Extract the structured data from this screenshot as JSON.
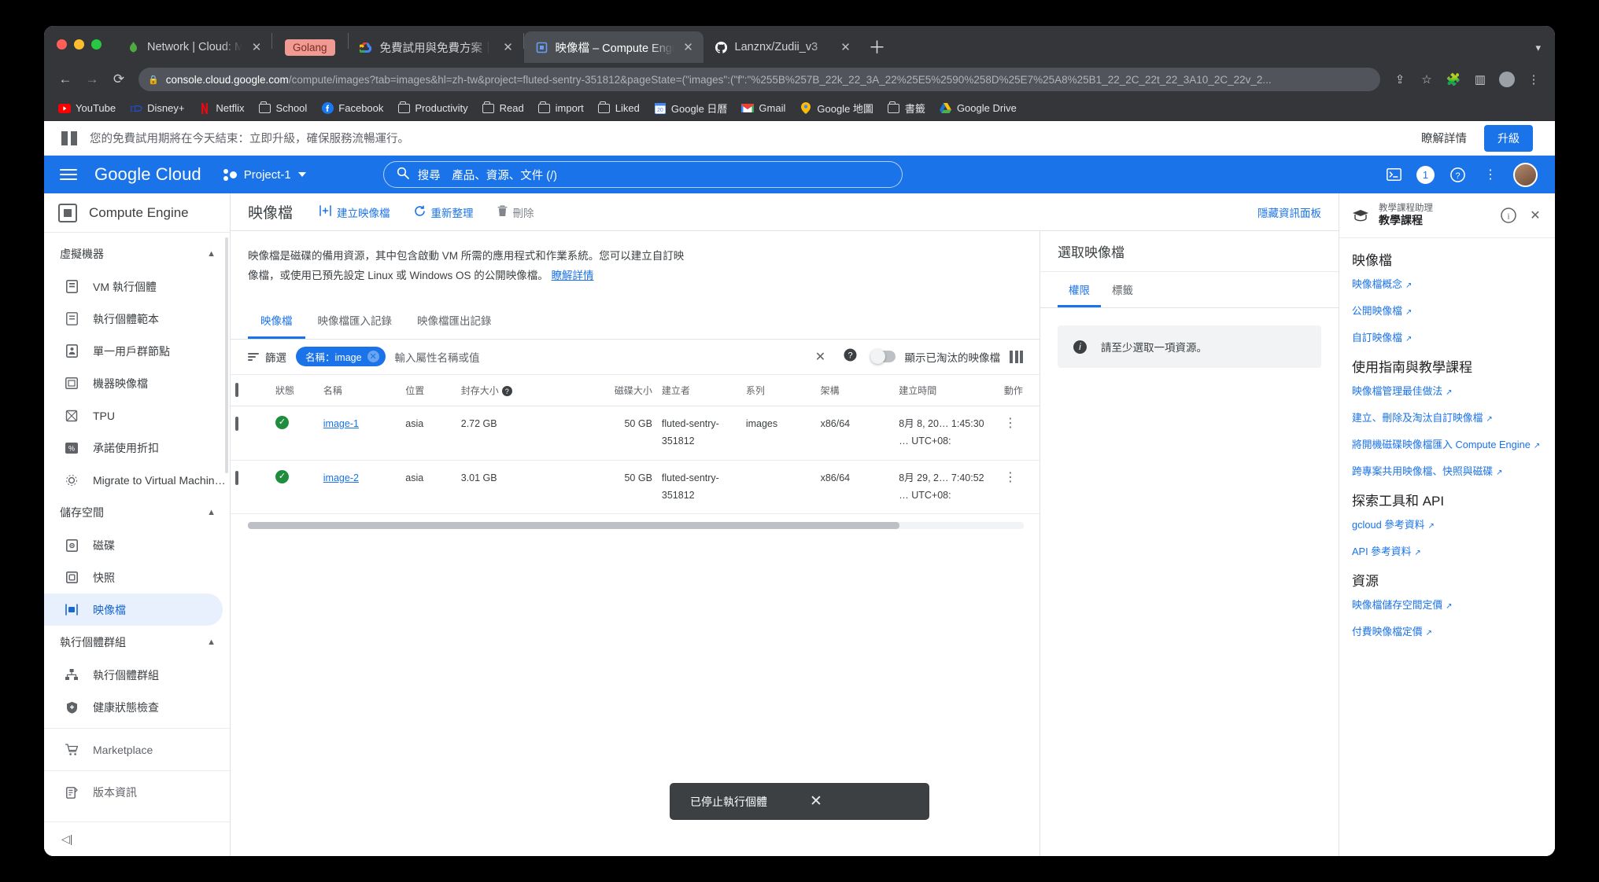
{
  "browser": {
    "tabs": [
      {
        "title": "Network | Cloud: MongoDB Clo",
        "favicon": "mongodb-icon",
        "active": false
      },
      {
        "title": "Golang",
        "favicon": "golang-pill",
        "active": false,
        "pill": true
      },
      {
        "title": "免費試用與免費方案｜Google C",
        "favicon": "google-cloud-icon",
        "active": false
      },
      {
        "title": "映像檔 – Compute Engine – Pro",
        "favicon": "compute-engine-icon",
        "active": true
      },
      {
        "title": "Lanznx/Zudii_v3",
        "favicon": "github-icon",
        "active": false
      }
    ],
    "close_label": "✕",
    "new_tab_label": "＋",
    "url_host": "console.cloud.google.com",
    "url_rest": "/compute/images?tab=images&hl=zh-tw&project=fluted-sentry-351812&pageState=(\"images\":(\"f\":\"%255B%257B_22k_22_3A_22%25E5%2590%258D%25E7%25A8%25B1_22_2C_22t_22_3A10_2C_22v_2...",
    "bookmarks": [
      {
        "label": "YouTube",
        "icon": "youtube-icon"
      },
      {
        "label": "Disney+",
        "icon": "disney-icon"
      },
      {
        "label": "Netflix",
        "icon": "netflix-icon"
      },
      {
        "label": "School",
        "icon": "folder-icon"
      },
      {
        "label": "Facebook",
        "icon": "facebook-icon"
      },
      {
        "label": "Productivity",
        "icon": "folder-icon"
      },
      {
        "label": "Read",
        "icon": "folder-icon"
      },
      {
        "label": "import",
        "icon": "folder-icon"
      },
      {
        "label": "Liked",
        "icon": "folder-icon"
      },
      {
        "label": "Google 日曆",
        "icon": "google-calendar-icon"
      },
      {
        "label": "Gmail",
        "icon": "gmail-icon"
      },
      {
        "label": "Google 地圖",
        "icon": "google-maps-icon"
      },
      {
        "label": "書籤",
        "icon": "folder-icon"
      },
      {
        "label": "Google Drive",
        "icon": "google-drive-icon"
      }
    ]
  },
  "trial_banner": {
    "message": "您的免費試用期將在今天結束：立即升級，確保服務流暢運行。",
    "learn_more": "瞭解詳情",
    "upgrade": "升級"
  },
  "gcloud_header": {
    "logo": "Google Cloud",
    "project": "Project-1",
    "search_placeholder": "搜尋　產品、資源、文件 (/)",
    "notification_count": "1"
  },
  "sidebar": {
    "product": "Compute Engine",
    "groups": [
      {
        "label": "虛擬機器",
        "items": [
          {
            "label": "VM 執行個體",
            "icon": "vm-instance-icon"
          },
          {
            "label": "執行個體範本",
            "icon": "instance-template-icon"
          },
          {
            "label": "單一用戶群節點",
            "icon": "sole-tenant-node-icon"
          },
          {
            "label": "機器映像檔",
            "icon": "machine-image-icon"
          },
          {
            "label": "TPU",
            "icon": "tpu-icon"
          },
          {
            "label": "承諾使用折扣",
            "icon": "percent-icon"
          },
          {
            "label": "Migrate to Virtual Machin…",
            "icon": "migrate-icon"
          }
        ]
      },
      {
        "label": "儲存空間",
        "items": [
          {
            "label": "磁碟",
            "icon": "disk-icon"
          },
          {
            "label": "快照",
            "icon": "snapshot-icon"
          },
          {
            "label": "映像檔",
            "icon": "image-icon",
            "active": true
          }
        ]
      },
      {
        "label": "執行個體群組",
        "items": [
          {
            "label": "執行個體群組",
            "icon": "instance-group-icon"
          },
          {
            "label": "健康狀態檢查",
            "icon": "health-check-icon"
          }
        ]
      }
    ],
    "extras": [
      {
        "label": "Marketplace",
        "icon": "marketplace-icon"
      },
      {
        "label": "版本資訊",
        "icon": "release-notes-icon"
      }
    ],
    "collapse": "◁|"
  },
  "main": {
    "title": "映像檔",
    "actions": [
      {
        "label": "建立映像檔",
        "icon": "create-image-icon",
        "enabled": true
      },
      {
        "label": "重新整理",
        "icon": "refresh-icon",
        "enabled": true
      },
      {
        "label": "刪除",
        "icon": "delete-icon",
        "enabled": false
      }
    ],
    "hide_panel": "隱藏資訊面板",
    "description": "映像檔是磁碟的備用資源，其中包含啟動 VM 所需的應用程式和作業系統。您可以建立自訂映像檔，或使用已預先設定 Linux 或 Windows OS 的公開映像檔。",
    "description_link": "瞭解詳情",
    "tabs": [
      {
        "label": "映像檔",
        "selected": true
      },
      {
        "label": "映像檔匯入記錄",
        "selected": false
      },
      {
        "label": "映像檔匯出記錄",
        "selected": false
      }
    ],
    "filter": {
      "label": "篩選",
      "chip": "名稱：image",
      "chip_remove": "✕",
      "placeholder": "輸入屬性名稱或值",
      "clear": "✕",
      "help": "?",
      "toggle_label": "顯示已淘汰的映像檔",
      "toggle_on": false
    },
    "table": {
      "columns": [
        "狀態",
        "名稱",
        "位置",
        "封存大小",
        "磁碟大小",
        "建立者",
        "系列",
        "架構",
        "建立時間",
        "動作"
      ],
      "rows": [
        {
          "status": "ok",
          "name": "image-1",
          "location": "asia",
          "archive_size": "2.72 GB",
          "disk_size": "50 GB",
          "creator": "fluted-sentry-351812",
          "family": "images",
          "arch": "x86/64",
          "created": "8月 8, 20… 1:45:30 … UTC+08:"
        },
        {
          "status": "ok",
          "name": "image-2",
          "location": "asia",
          "archive_size": "3.01 GB",
          "disk_size": "50 GB",
          "creator": "fluted-sentry-351812",
          "family": "",
          "arch": "x86/64",
          "created": "8月 29, 2… 7:40:52 … UTC+08:"
        }
      ]
    }
  },
  "info_panel": {
    "title": "選取映像檔",
    "tabs": [
      {
        "label": "權限",
        "selected": true
      },
      {
        "label": "標籤",
        "selected": false
      }
    ],
    "notice": "請至少選取一項資源。"
  },
  "help_panel": {
    "subtitle": "教學課程助理",
    "title": "教學課程",
    "info_icon": "info-icon",
    "close_icon": "close-icon",
    "sections": [
      {
        "heading": "映像檔",
        "links": [
          "映像檔概念",
          "公開映像檔",
          "自訂映像檔"
        ]
      },
      {
        "heading": "使用指南與教學課程",
        "links": [
          "映像檔管理最佳做法",
          "建立、刪除及淘汰自訂映像檔",
          "將開機磁碟映像檔匯入 Compute Engine",
          "跨專案共用映像檔、快照與磁碟"
        ]
      },
      {
        "heading": "探索工具和 API",
        "links": [
          "gcloud 參考資料",
          "API 參考資料"
        ]
      },
      {
        "heading": "資源",
        "links": [
          "映像檔儲存空間定價",
          "付費映像檔定價"
        ]
      }
    ]
  },
  "toast": {
    "message": "已停止執行個體",
    "close": "✕"
  },
  "colors": {
    "accent": "#1a73e8",
    "status_ok": "#1e8e3e",
    "toast_bg": "#3c4043",
    "chip_bg": "#1a73e8"
  }
}
